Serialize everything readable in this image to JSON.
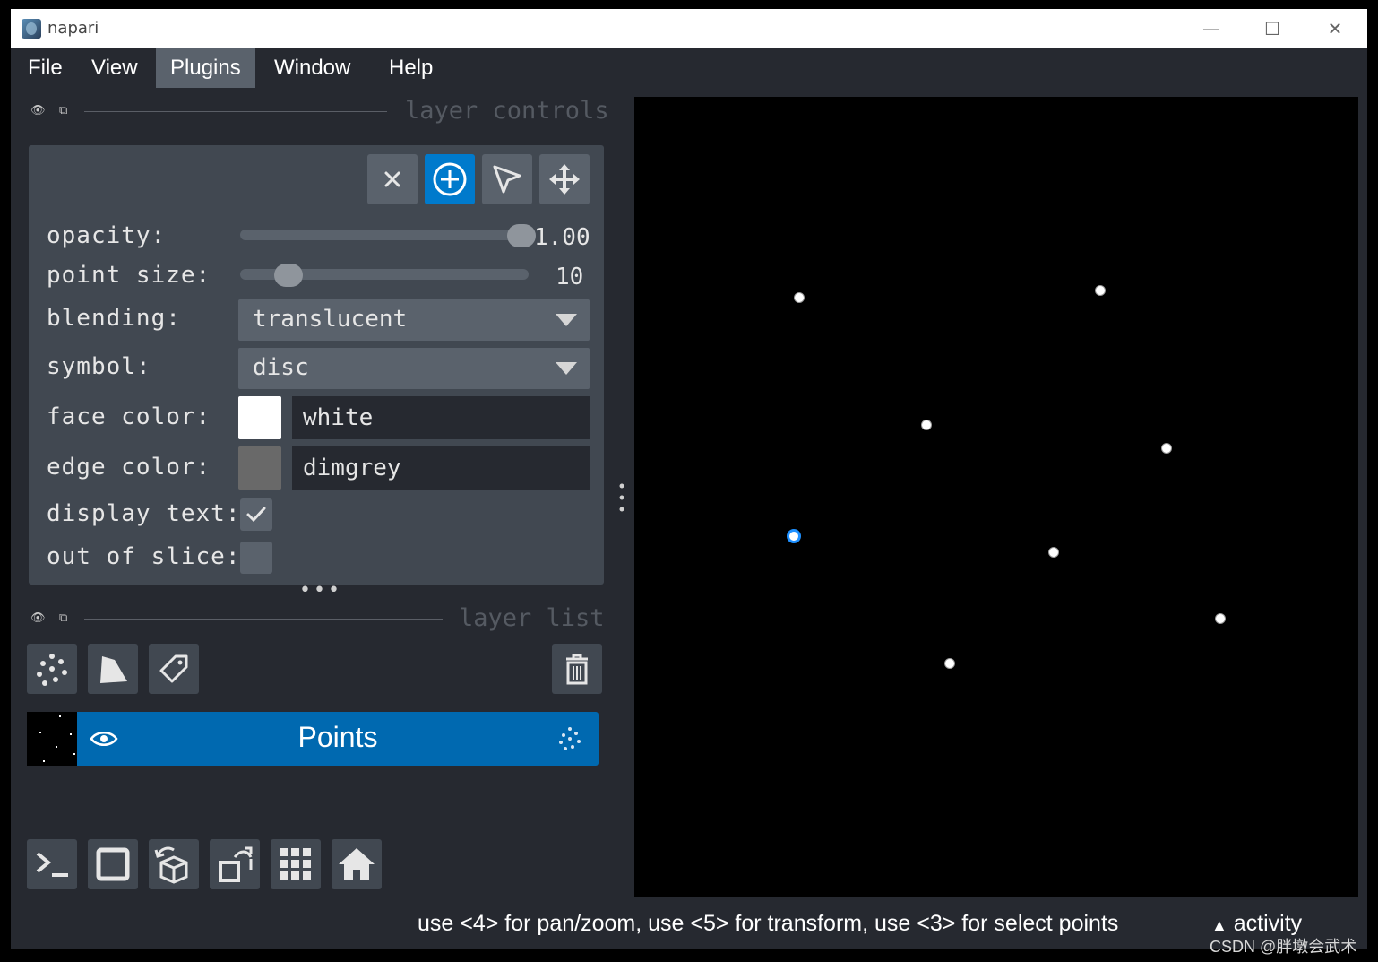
{
  "window": {
    "title": "napari",
    "minimize": "—",
    "maximize": "☐",
    "close": "✕"
  },
  "menu": [
    "File",
    "View",
    "Plugins",
    "Window",
    "Help"
  ],
  "active_menu": "Plugins",
  "layer_controls": {
    "section_title": "layer controls",
    "opacity": {
      "label": "opacity:",
      "value": "1.00",
      "fraction": 1.0
    },
    "point_size": {
      "label": "point size:",
      "value": "10",
      "fraction": 0.13
    },
    "blending": {
      "label": "blending:",
      "value": "translucent"
    },
    "symbol": {
      "label": "symbol:",
      "value": "disc"
    },
    "face_color": {
      "label": "face color:",
      "value": "white",
      "swatch": "#ffffff"
    },
    "edge_color": {
      "label": "edge color:",
      "value": "dimgrey",
      "swatch": "#696969"
    },
    "display_text": {
      "label": "display text:",
      "checked": true
    },
    "out_of_slice": {
      "label": "out of slice:",
      "checked": false
    }
  },
  "layer_list": {
    "section_title": "layer list",
    "layers": [
      {
        "name": "Points",
        "visible": true,
        "selected": true
      }
    ]
  },
  "status": {
    "message": "use <4> for pan/zoom, use <5> for transform, use <3> for select points",
    "activity": "activity"
  },
  "watermark": "CSDN @胖墩会武术",
  "colors": {
    "accent": "#007acc",
    "selected_layer": "#0069b0",
    "background": "#262930",
    "panel": "#414851"
  }
}
